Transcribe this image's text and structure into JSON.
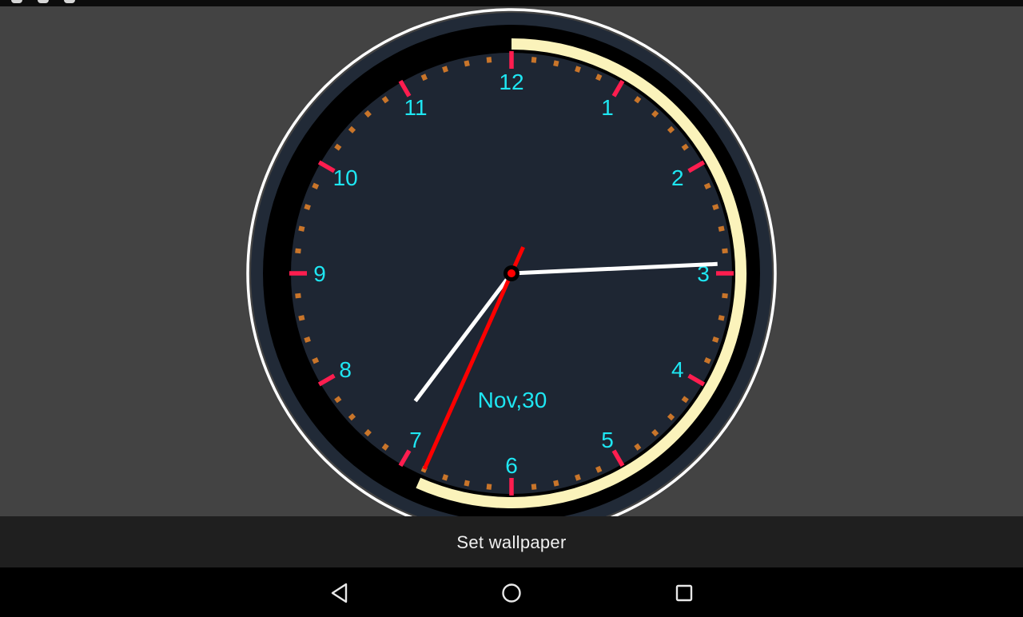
{
  "clock": {
    "numerals": [
      "12",
      "1",
      "2",
      "3",
      "4",
      "5",
      "6",
      "7",
      "8",
      "9",
      "10",
      "11"
    ],
    "date": "Nov,30",
    "time": {
      "hour": 7,
      "minute": 14,
      "second": 34
    },
    "colors": {
      "face": "#1e2633",
      "numerals": "#1ee6f2",
      "hour_ticks": "#ff1d4f",
      "minute_ticks": "#c9752a",
      "seconds_arc": "#fbf3bb",
      "hands": "#ffffff",
      "second_hand": "#ff0000",
      "outer_ring": "#ffffff"
    }
  },
  "action_bar": {
    "set_wallpaper_label": "Set wallpaper"
  },
  "navigation": {
    "back_icon": "back-triangle-icon",
    "home_icon": "home-circle-icon",
    "recents_icon": "recents-square-icon"
  }
}
